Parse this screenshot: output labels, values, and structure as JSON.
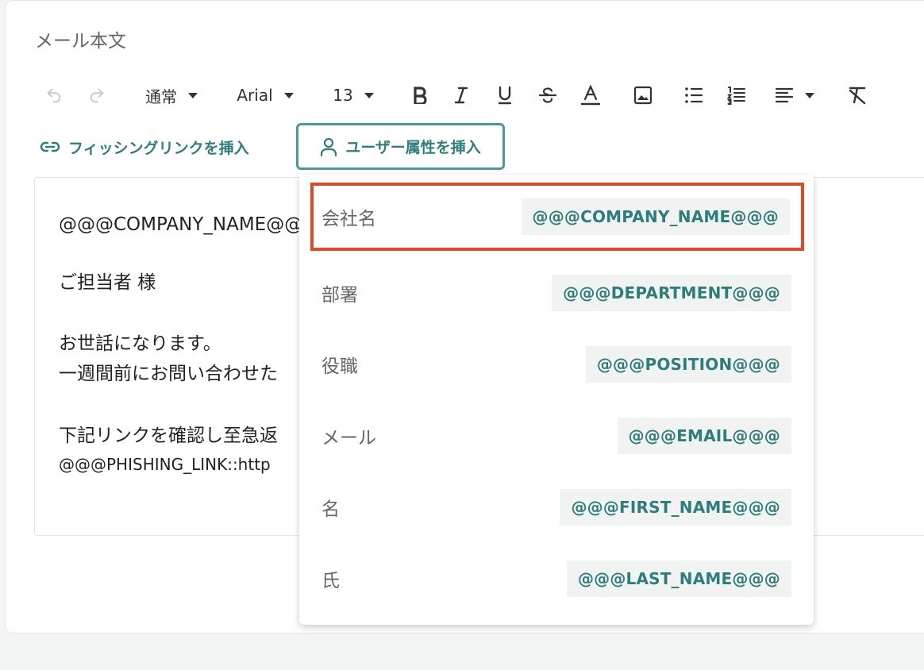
{
  "section_label": "メール本文",
  "toolbar": {
    "paragraph_style": "通常",
    "font_family": "Arial",
    "font_size": "13",
    "icons": [
      "undo-icon",
      "redo-icon",
      "bold-icon",
      "italic-icon",
      "underline-icon",
      "strikethrough-icon",
      "text-color-icon",
      "image-icon",
      "bullet-list-icon",
      "numbered-list-icon",
      "align-icon",
      "clear-format-icon"
    ]
  },
  "insert_phishing_link_label": "フィッシングリンクを挿入",
  "insert_user_attribute_label": "ユーザー属性を挿入",
  "editor": {
    "lines": [
      "@@@COMPANY_NAME@@@",
      "ご担当者 様",
      "お世話になります。",
      "一週間前にお問い合わせた",
      "下記リンクを確認し至急返",
      "@@@PHISHING_LINK::http"
    ]
  },
  "attribute_menu": {
    "items": [
      {
        "label": "会社名",
        "code": "@@@COMPANY_NAME@@@"
      },
      {
        "label": "部署",
        "code": "@@@DEPARTMENT@@@"
      },
      {
        "label": "役職",
        "code": "@@@POSITION@@@"
      },
      {
        "label": "メール",
        "code": "@@@EMAIL@@@"
      },
      {
        "label": "名",
        "code": "@@@FIRST_NAME@@@"
      },
      {
        "label": "氏",
        "code": "@@@LAST_NAME@@@"
      }
    ],
    "highlighted_index": 0
  },
  "colors": {
    "accent": "#2f7d7b",
    "accent_border": "#4a9a97",
    "highlight": "#e04a26",
    "code_bg": "#f1f3f3"
  }
}
